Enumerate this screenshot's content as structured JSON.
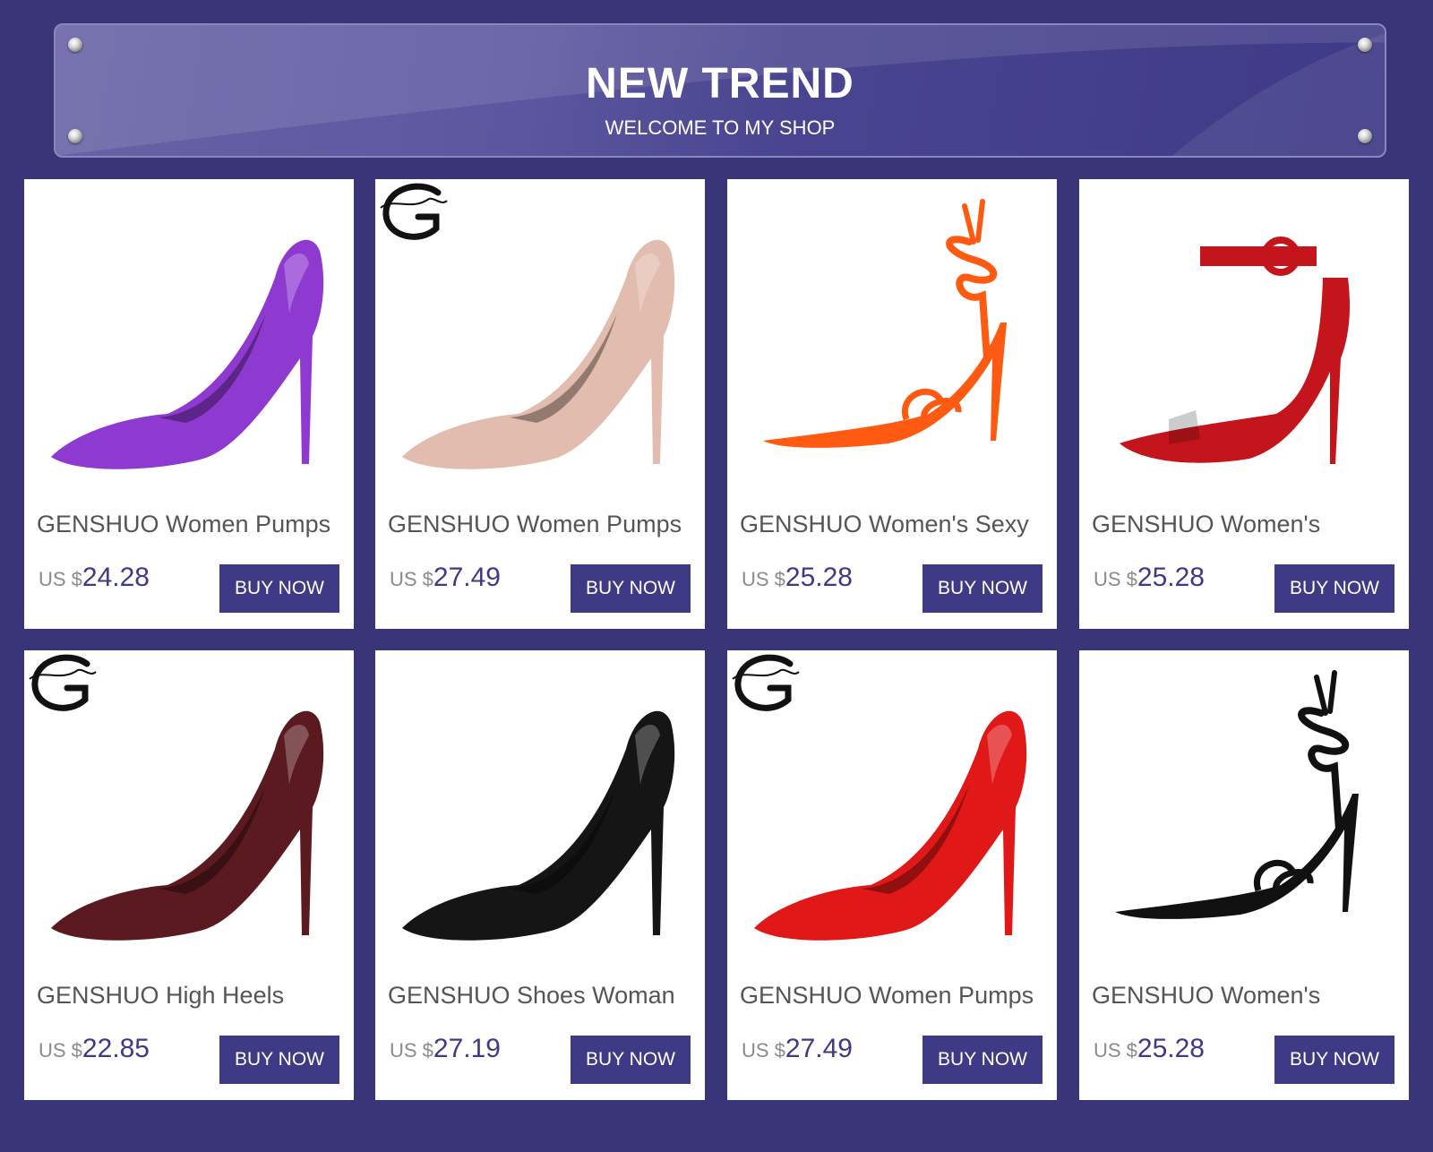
{
  "banner": {
    "title": "NEW TREND",
    "subtitle": "WELCOME TO MY SHOP"
  },
  "currency_prefix": "US $",
  "buy_label": "BUY NOW",
  "products": [
    {
      "name": "GENSHUO Women Pumps",
      "price": "24.28",
      "color": "#8e3ad0",
      "style": "pump",
      "logo": false
    },
    {
      "name": "GENSHUO Women Pumps",
      "price": "27.49",
      "color": "#e2bcae",
      "style": "pump",
      "logo": true
    },
    {
      "name": "GENSHUO Women's Sexy",
      "price": "25.28",
      "color": "#ff5a12",
      "style": "lace-sandal",
      "logo": false
    },
    {
      "name": "GENSHUO Women's",
      "price": "25.28",
      "color": "#c4141c",
      "style": "ankle-strap-sandal",
      "logo": false
    },
    {
      "name": "GENSHUO High Heels",
      "price": "22.85",
      "color": "#5a1a20",
      "style": "pump",
      "logo": true
    },
    {
      "name": "GENSHUO Shoes Woman",
      "price": "27.19",
      "color": "#151515",
      "style": "pump",
      "logo": false
    },
    {
      "name": "GENSHUO Women Pumps",
      "price": "27.49",
      "color": "#e01818",
      "style": "pump",
      "logo": true
    },
    {
      "name": "GENSHUO Women's",
      "price": "25.28",
      "color": "#111111",
      "style": "lace-sandal",
      "logo": false
    }
  ],
  "colors": {
    "page_bg": "#3a3479",
    "button_bg": "#3f3a86",
    "price_text": "#3f3a86"
  }
}
